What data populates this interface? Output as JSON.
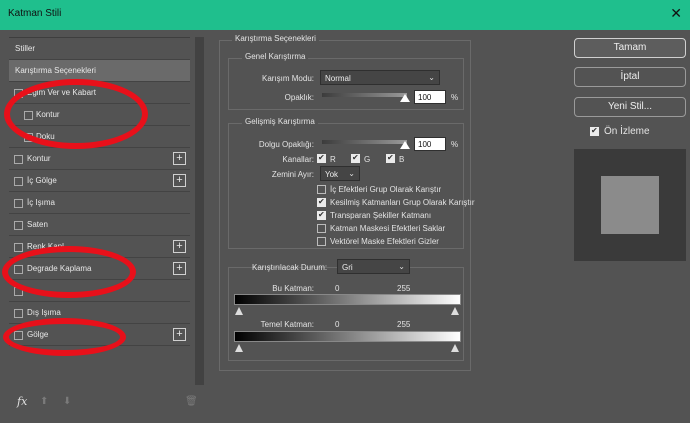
{
  "window": {
    "title": "Katman Stili",
    "close_symbol": "✕"
  },
  "left_list": {
    "items": [
      {
        "label": "Stiller",
        "checkbox": false,
        "plus": false
      },
      {
        "label": "Karıştırma Seçenekleri",
        "checkbox": false,
        "plus": false,
        "selected": true
      },
      {
        "label": "Eğim Ver ve Kabart",
        "checkbox": true,
        "plus": false
      },
      {
        "label": "Kontur",
        "checkbox": true,
        "plus": false,
        "indent": true
      },
      {
        "label": "Doku",
        "checkbox": true,
        "plus": false,
        "indent": true
      },
      {
        "label": "Kontur",
        "checkbox": true,
        "plus": true
      },
      {
        "label": "İç Gölge",
        "checkbox": true,
        "plus": true
      },
      {
        "label": "İç Işıma",
        "checkbox": true,
        "plus": false
      },
      {
        "label": "Saten",
        "checkbox": true,
        "plus": false
      },
      {
        "label": "Renk Kapl",
        "checkbox": true,
        "plus": true
      },
      {
        "label": "Degrade Kaplama",
        "checkbox": true,
        "plus": true
      },
      {
        "label": "",
        "checkbox": true,
        "plus": false
      },
      {
        "label": "Dış Işıma",
        "checkbox": true,
        "plus": false
      },
      {
        "label": "Gölge",
        "checkbox": true,
        "plus": true
      }
    ],
    "fx_label": "fx",
    "up_symbol": "⬆",
    "down_symbol": "⬇",
    "trash_symbol": "🗑"
  },
  "blending": {
    "section_title": "Karıştırma Seçenekleri",
    "general": {
      "title": "Genel Karıştırma",
      "mode_label": "Karışım Modu:",
      "mode_value": "Normal",
      "opacity_label": "Opaklık:",
      "opacity_value": "100",
      "percent": "%"
    },
    "advanced": {
      "title": "Gelişmiş Karıştırma",
      "fill_opacity_label": "Dolgu Opaklığı:",
      "fill_opacity_value": "100",
      "percent": "%",
      "channels_label": "Kanallar:",
      "channels": [
        {
          "label": "R",
          "checked": true
        },
        {
          "label": "G",
          "checked": true
        },
        {
          "label": "B",
          "checked": true
        }
      ],
      "knockout_label": "Zemini Ayır:",
      "knockout_value": "Yok",
      "options": [
        {
          "label": "İç Efektleri Grup Olarak Karıştır",
          "checked": false
        },
        {
          "label": "Kesilmiş Katmanları Grup Olarak Karıştır",
          "checked": true
        },
        {
          "label": "Transparan Şekiller Katmanı",
          "checked": true
        },
        {
          "label": "Katman Maskesi Efektleri Saklar",
          "checked": false
        },
        {
          "label": "Vektörel Maske Efektleri Gizler",
          "checked": false
        }
      ]
    },
    "blend_if": {
      "label": "Karıştırılacak Durum:",
      "value": "Gri",
      "this_layer_label": "Bu Katman:",
      "this_layer_min": "0",
      "this_layer_max": "255",
      "underlying_label": "Temel Katman:",
      "underlying_min": "0",
      "underlying_max": "255"
    }
  },
  "buttons": {
    "ok": "Tamam",
    "cancel": "İptal",
    "new_style": "Yeni Stil...",
    "preview_label": "Ön İzleme",
    "preview_checked": true
  },
  "colors": {
    "titlebar": "#1fbf8d",
    "annotation_ring": "#e8101a"
  }
}
